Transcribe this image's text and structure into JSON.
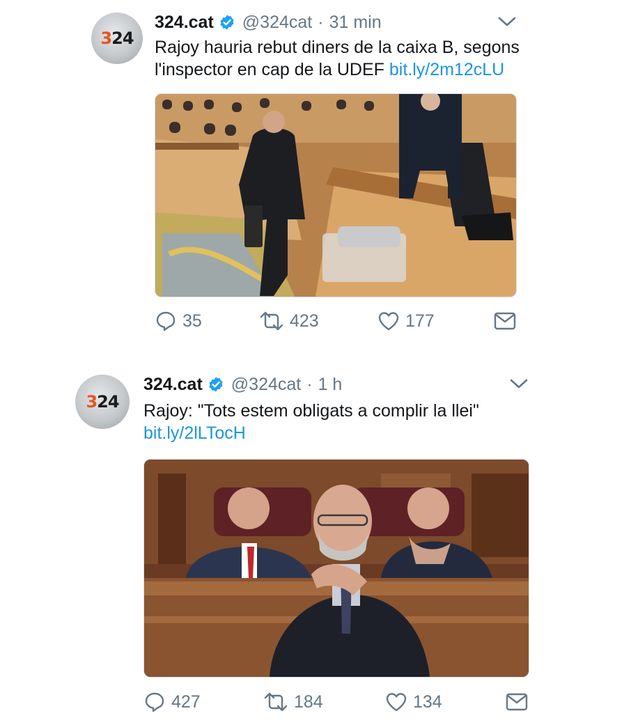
{
  "tweets": [
    {
      "avatar": {
        "logo_three": "3",
        "logo_rest": "24"
      },
      "name": "324.cat",
      "handle": "@324cat",
      "separator": "·",
      "time": "31 min",
      "text_line1": "Rajoy hauria rebut diners de la caixa B, segons",
      "text_line2": "l'inspector en cap de la UDEF",
      "link": "bit.ly/2m12cLU",
      "actions": {
        "replies": "35",
        "retweets": "423",
        "likes": "177"
      }
    },
    {
      "avatar": {
        "logo_three": "3",
        "logo_rest": "24"
      },
      "name": "324.cat",
      "handle": "@324cat",
      "separator": "·",
      "time": "1 h",
      "text_line1": "Rajoy: \"Tots estem obligats a complir la llei\"",
      "link": "bit.ly/2lLTocH",
      "actions": {
        "replies": "427",
        "retweets": "184",
        "likes": "134"
      }
    }
  ],
  "icons": [
    "verified-badge-icon",
    "chevron-down-icon",
    "reply-icon",
    "retweet-icon",
    "like-icon",
    "direct-message-icon"
  ],
  "colors": {
    "verified": "#1da1f2",
    "link": "#1b95e0",
    "secondary_text": "#657786",
    "logo_accent": "#e8541a"
  }
}
